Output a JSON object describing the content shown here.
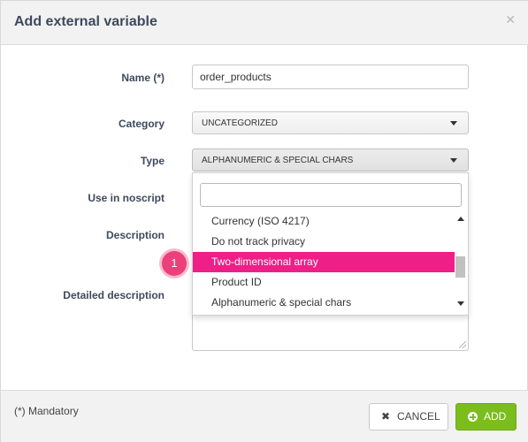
{
  "dialog": {
    "title": "Add external variable",
    "close_icon": "close-icon"
  },
  "form": {
    "name_label": "Name (*)",
    "name_value": "order_products",
    "category_label": "Category",
    "category_value": "UNCATEGORIZED",
    "type_label": "Type",
    "type_value": "ALPHANUMERIC & SPECIAL CHARS",
    "noscript_label": "Use in noscript",
    "description_label": "Description",
    "detailed_description_label": "Detailed description"
  },
  "dropdown": {
    "search_value": "",
    "items": [
      {
        "label": "Currency (ISO 4217)"
      },
      {
        "label": "Do not track privacy"
      },
      {
        "label": "Two-dimensional array"
      },
      {
        "label": "Product ID"
      },
      {
        "label": "Alphanumeric & special chars"
      }
    ],
    "selected_index": 2,
    "selected_color": "#ee1f87"
  },
  "annotation": {
    "step": "1",
    "color": "#ec407a"
  },
  "footer": {
    "mandatory_note": "(*) Mandatory",
    "cancel_label": "CANCEL",
    "add_label": "ADD",
    "add_color": "#7cbd1e"
  }
}
